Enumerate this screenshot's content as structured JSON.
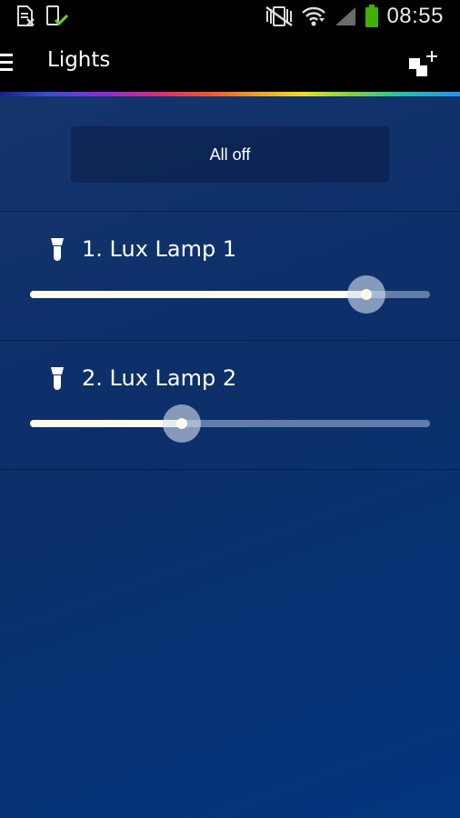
{
  "status_bar": {
    "time": "08:55",
    "icons": [
      "file-x-icon",
      "phone-check-icon",
      "vibrate-mute-icon",
      "wifi-icon",
      "signal-icon",
      "battery-icon"
    ],
    "battery_color": "#3fb000"
  },
  "app_bar": {
    "title": "Lights",
    "menu_icon": "hamburger-menu-icon",
    "action_icon": "add-scene-icon"
  },
  "accent_colors": {
    "background": "#0c2f6a",
    "slider_fill": "#fffbea"
  },
  "controls": {
    "all_off_label": "All off"
  },
  "lamps": [
    {
      "name": "1. Lux Lamp 1",
      "icon": "bulb-icon",
      "brightness": 0.84
    },
    {
      "name": "2. Lux Lamp 2",
      "icon": "bulb-icon",
      "brightness": 0.38
    }
  ]
}
